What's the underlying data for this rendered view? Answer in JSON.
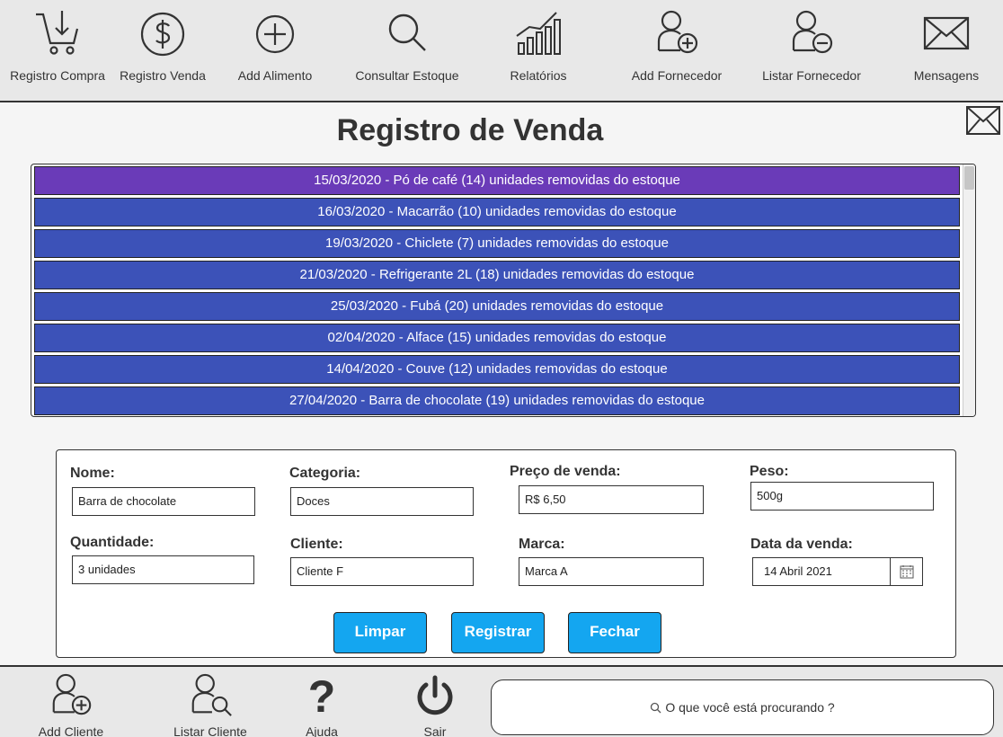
{
  "toolbar": {
    "items": [
      {
        "label": "Registro Compra",
        "icon": "cart-download-icon"
      },
      {
        "label": "Registro Venda",
        "icon": "dollar-icon"
      },
      {
        "label": "Add Alimento",
        "icon": "plus-circle-icon"
      },
      {
        "label": "Consultar Estoque",
        "icon": "search-icon"
      },
      {
        "label": "Relatórios",
        "icon": "bar-chart-icon"
      },
      {
        "label": "Add Fornecedor",
        "icon": "user-plus-icon"
      },
      {
        "label": "Listar Fornecedor",
        "icon": "user-minus-icon"
      },
      {
        "label": "Mensagens",
        "icon": "mail-icon"
      }
    ]
  },
  "page": {
    "title": "Registro de Venda"
  },
  "sales_list": [
    "15/03/2020 - Pó de café (14) unidades removidas do estoque",
    "16/03/2020 - Macarrão (10) unidades removidas do estoque",
    "19/03/2020 - Chiclete (7) unidades removidas do estoque",
    "21/03/2020 - Refrigerante 2L (18) unidades removidas do estoque",
    "25/03/2020 - Fubá (20) unidades removidas do estoque",
    "02/04/2020 - Alface (15) unidades removidas do estoque",
    "14/04/2020 - Couve (12) unidades removidas do estoque",
    "27/04/2020 - Barra de chocolate (19) unidades removidas do estoque"
  ],
  "form": {
    "nome": {
      "label": "Nome:",
      "value": "Barra de chocolate"
    },
    "categoria": {
      "label": "Categoria:",
      "value": "Doces"
    },
    "preco": {
      "label": "Preço de venda:",
      "value": "R$ 6,50"
    },
    "peso": {
      "label": "Peso:",
      "value": "500g"
    },
    "quantidade": {
      "label": "Quantidade:",
      "value": "3 unidades"
    },
    "cliente": {
      "label": "Cliente:",
      "value": "Cliente F"
    },
    "marca": {
      "label": "Marca:",
      "value": "Marca A"
    },
    "data": {
      "label": "Data da venda:",
      "value": "14 Abril 2021"
    },
    "buttons": {
      "limpar": "Limpar",
      "registrar": "Registrar",
      "fechar": "Fechar"
    }
  },
  "bottombar": {
    "items": [
      {
        "label": "Add Cliente",
        "icon": "user-plus-icon"
      },
      {
        "label": "Listar Cliente",
        "icon": "user-search-icon"
      },
      {
        "label": "Ajuda",
        "icon": "help-icon"
      },
      {
        "label": "Sair",
        "icon": "power-icon"
      }
    ],
    "search_placeholder": "O que você está procurando ?"
  },
  "colors": {
    "list_item": "#3c52b8",
    "list_selected": "#6a3bb8",
    "button": "#14a6f0"
  }
}
